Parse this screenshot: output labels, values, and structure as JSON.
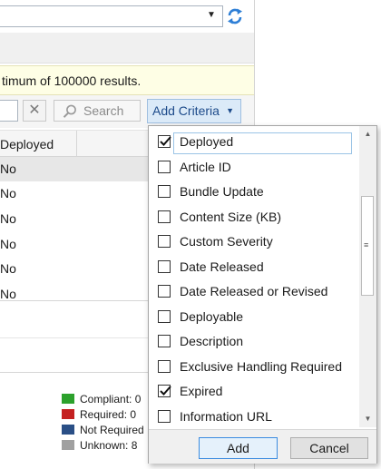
{
  "notice": {
    "text": "timum of 100000 results."
  },
  "toolbar": {
    "clear_icon": "close-icon",
    "search_label": "Search",
    "add_criteria_label": "Add Criteria"
  },
  "grid": {
    "column_header": "Deployed",
    "rows": [
      "No",
      "No",
      "No",
      "No",
      "No",
      "No"
    ]
  },
  "legend": [
    {
      "label": "Compliant: 0",
      "color": "#2ca12c"
    },
    {
      "label": "Required: 0",
      "color": "#c42020"
    },
    {
      "label": "Not Required",
      "color": "#2a4f86"
    },
    {
      "label": "Unknown: 8",
      "color": "#a0a0a0"
    }
  ],
  "criteria_popup": {
    "items": [
      {
        "label": "Deployed",
        "checked": true
      },
      {
        "label": "Article ID",
        "checked": false
      },
      {
        "label": "Bundle Update",
        "checked": false
      },
      {
        "label": "Content Size (KB)",
        "checked": false
      },
      {
        "label": "Custom Severity",
        "checked": false
      },
      {
        "label": "Date Released",
        "checked": false
      },
      {
        "label": "Date Released or Revised",
        "checked": false
      },
      {
        "label": "Deployable",
        "checked": false
      },
      {
        "label": "Description",
        "checked": false
      },
      {
        "label": "Exclusive Handling Required",
        "checked": false
      },
      {
        "label": "Expired",
        "checked": true
      },
      {
        "label": "Information URL",
        "checked": false
      }
    ],
    "add_label": "Add",
    "cancel_label": "Cancel"
  }
}
